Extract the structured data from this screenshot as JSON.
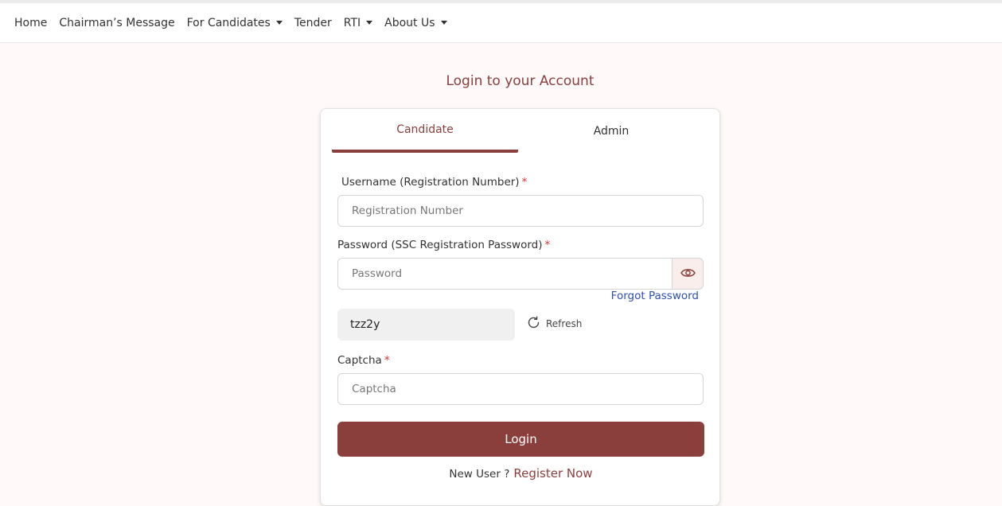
{
  "nav": {
    "items": [
      {
        "label": "Home",
        "dropdown": false
      },
      {
        "label": "Chairman’s Message",
        "dropdown": false
      },
      {
        "label": "For Candidates",
        "dropdown": true
      },
      {
        "label": "Tender",
        "dropdown": false
      },
      {
        "label": "RTI",
        "dropdown": true
      },
      {
        "label": "About Us",
        "dropdown": true
      }
    ]
  },
  "page": {
    "title": "Login to your Account"
  },
  "tabs": [
    {
      "label": "Candidate",
      "active": true
    },
    {
      "label": "Admin",
      "active": false
    }
  ],
  "form": {
    "username_label": "Username (Registration Number)",
    "username_placeholder": "Registration Number",
    "password_label": "Password (SSC Registration Password)",
    "password_placeholder": "Password",
    "forgot_label": "Forgot Password",
    "captcha_value": "tzz2y",
    "refresh_label": "Refresh",
    "captcha_label": "Captcha",
    "captcha_placeholder": "Captcha",
    "required_mark": "*",
    "login_label": "Login",
    "new_user_text": "New User ?",
    "register_label": "Register Now"
  },
  "colors": {
    "accent": "#8b3f3c",
    "link": "#2f4fb5",
    "required": "#d9302c"
  }
}
